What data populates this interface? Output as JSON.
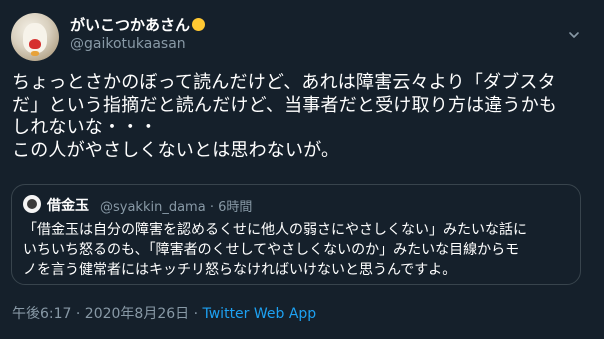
{
  "author": {
    "display_name": "がいこつかあさん",
    "handle": "@gaikotukaasan"
  },
  "tweet": {
    "lines": [
      "ちょっとさかのぼって読んだけど、あれは障害云々より「ダブスタ",
      "だ」という指摘だと読んだけど、当事者だと受け取り方は違うかも",
      "しれないな・・・",
      "この人がやさしくないとは思わないが。"
    ]
  },
  "quoted": {
    "display_name": "借金玉",
    "handle": "@syakkin_dama",
    "separator": "·",
    "time": "6時間",
    "lines": [
      "「借金玉は自分の障害を認めるくせに他人の弱さにやさしくない」みたいな話に",
      "いちいち怒るのも、「障害者のくせしてやさしくないのか」みたいな目線からモ",
      "ノを言う健常者にはキッチリ怒らなければいけないと思うんですよ。"
    ]
  },
  "footer": {
    "timestamp": "午後6:17 · 2020年8月26日 · ",
    "source": "Twitter Web App"
  },
  "icons": {
    "caret": "chevron-down-icon",
    "verified_badge": "circle-badge-icon"
  },
  "colors": {
    "background": "#15202b",
    "secondary_text": "#8899a6",
    "link": "#1da1f2",
    "border": "#38444d",
    "badge": "#ffc832"
  }
}
